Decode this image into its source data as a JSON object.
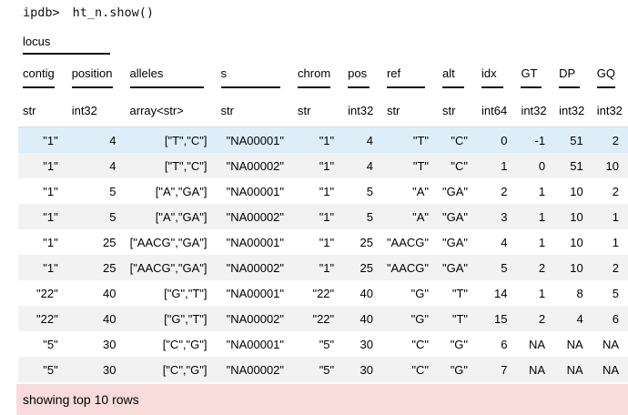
{
  "prompt": {
    "label": "ipdb>",
    "command": "ht_n.show()"
  },
  "table": {
    "group_header": "locus",
    "columns": [
      {
        "name": "contig",
        "type": "str"
      },
      {
        "name": "position",
        "type": "int32"
      },
      {
        "name": "alleles",
        "type": "array<str>"
      },
      {
        "name": "s",
        "type": "str"
      },
      {
        "name": "chrom",
        "type": "str"
      },
      {
        "name": "pos",
        "type": "int32"
      },
      {
        "name": "ref",
        "type": "str"
      },
      {
        "name": "alt",
        "type": "str"
      },
      {
        "name": "idx",
        "type": "int64"
      },
      {
        "name": "GT",
        "type": "int32"
      },
      {
        "name": "DP",
        "type": "int32"
      },
      {
        "name": "GQ",
        "type": "int32"
      }
    ],
    "rows": [
      [
        "\"1\"",
        "4",
        "[\"T\",\"C\"]",
        "\"NA00001\"",
        "\"1\"",
        "4",
        "\"T\"",
        "\"C\"",
        "0",
        "-1",
        "51",
        "2"
      ],
      [
        "\"1\"",
        "4",
        "[\"T\",\"C\"]",
        "\"NA00002\"",
        "\"1\"",
        "4",
        "\"T\"",
        "\"C\"",
        "1",
        "0",
        "51",
        "10"
      ],
      [
        "\"1\"",
        "5",
        "[\"A\",\"GA\"]",
        "\"NA00001\"",
        "\"1\"",
        "5",
        "\"A\"",
        "\"GA\"",
        "2",
        "1",
        "10",
        "2"
      ],
      [
        "\"1\"",
        "5",
        "[\"A\",\"GA\"]",
        "\"NA00002\"",
        "\"1\"",
        "5",
        "\"A\"",
        "\"GA\"",
        "3",
        "1",
        "10",
        "1"
      ],
      [
        "\"1\"",
        "25",
        "[\"AACG\",\"GA\"]",
        "\"NA00001\"",
        "\"1\"",
        "25",
        "\"AACG\"",
        "\"GA\"",
        "4",
        "1",
        "10",
        "1"
      ],
      [
        "\"1\"",
        "25",
        "[\"AACG\",\"GA\"]",
        "\"NA00002\"",
        "\"1\"",
        "25",
        "\"AACG\"",
        "\"GA\"",
        "5",
        "2",
        "10",
        "2"
      ],
      [
        "\"22\"",
        "40",
        "[\"G\",\"T\"]",
        "\"NA00001\"",
        "\"22\"",
        "40",
        "\"G\"",
        "\"T\"",
        "14",
        "1",
        "8",
        "5"
      ],
      [
        "\"22\"",
        "40",
        "[\"G\",\"T\"]",
        "\"NA00002\"",
        "\"22\"",
        "40",
        "\"G\"",
        "\"T\"",
        "15",
        "2",
        "4",
        "6"
      ],
      [
        "\"5\"",
        "30",
        "[\"C\",\"G\"]",
        "\"NA00001\"",
        "\"5\"",
        "30",
        "\"C\"",
        "\"G\"",
        "6",
        "NA",
        "NA",
        "NA"
      ],
      [
        "\"5\"",
        "30",
        "[\"C\",\"G\"]",
        "\"NA00002\"",
        "\"5\"",
        "30",
        "\"C\"",
        "\"G\"",
        "7",
        "NA",
        "NA",
        "NA"
      ]
    ]
  },
  "footer": {
    "message": "showing top 10 rows",
    "color": "#f8dcdc"
  },
  "colors": {
    "highlight_row": "#ddeef9",
    "stripe_row": "#f2f2f2"
  }
}
